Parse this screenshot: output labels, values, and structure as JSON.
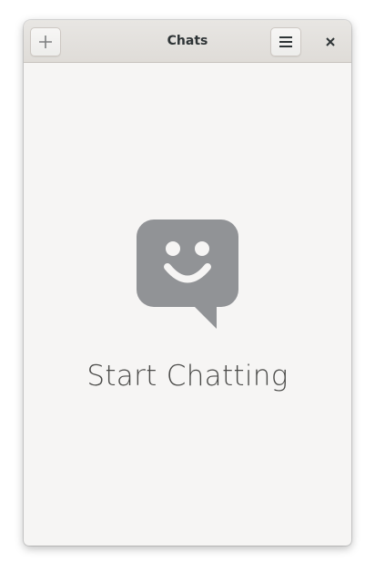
{
  "header": {
    "title": "Chats",
    "new_icon": "plus-icon",
    "menu_icon": "hamburger-menu-icon",
    "close_icon": "close-icon"
  },
  "empty_state": {
    "icon": "chat-smiley-icon",
    "label": "Start Chatting"
  },
  "colors": {
    "window_bg": "#f6f5f4",
    "headerbar": "#e1deda",
    "icon_gray": "#919396"
  }
}
